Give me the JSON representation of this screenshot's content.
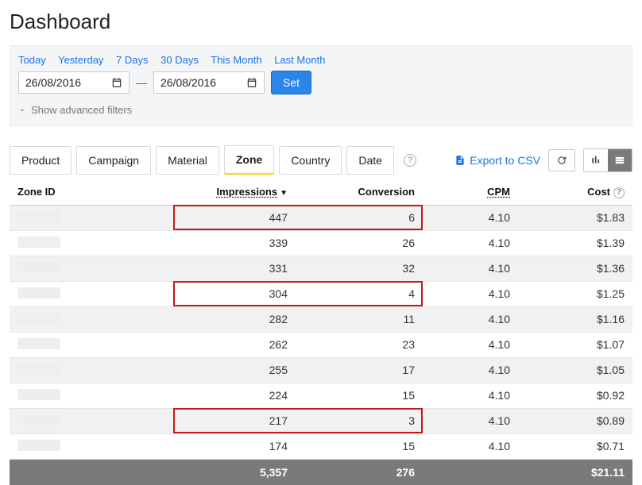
{
  "page": {
    "title": "Dashboard"
  },
  "filters": {
    "quick": {
      "today": "Today",
      "yesterday": "Yesterday",
      "d7": "7 Days",
      "d30": "30 Days",
      "this_month": "This Month",
      "last_month": "Last Month"
    },
    "date_from": "26/08/2016",
    "date_to": "26/08/2016",
    "set_label": "Set",
    "advanced_label": "Show advanced filters"
  },
  "tabs": {
    "product": "Product",
    "campaign": "Campaign",
    "material": "Material",
    "zone": "Zone",
    "country": "Country",
    "date": "Date",
    "active": "zone"
  },
  "toolbar": {
    "export_label": "Export to CSV"
  },
  "table": {
    "columns": {
      "zone_id": "Zone ID",
      "impressions": "Impressions",
      "conversion": "Conversion",
      "cpm": "CPM",
      "cost": "Cost"
    },
    "sort": {
      "column": "impressions",
      "dir": "desc"
    },
    "rows": [
      {
        "impressions": "447",
        "conversion": "6",
        "cpm": "4.10",
        "cost": "$1.83",
        "highlight": true
      },
      {
        "impressions": "339",
        "conversion": "26",
        "cpm": "4.10",
        "cost": "$1.39",
        "highlight": false
      },
      {
        "impressions": "331",
        "conversion": "32",
        "cpm": "4.10",
        "cost": "$1.36",
        "highlight": false
      },
      {
        "impressions": "304",
        "conversion": "4",
        "cpm": "4.10",
        "cost": "$1.25",
        "highlight": true
      },
      {
        "impressions": "282",
        "conversion": "11",
        "cpm": "4.10",
        "cost": "$1.16",
        "highlight": false
      },
      {
        "impressions": "262",
        "conversion": "23",
        "cpm": "4.10",
        "cost": "$1.07",
        "highlight": false
      },
      {
        "impressions": "255",
        "conversion": "17",
        "cpm": "4.10",
        "cost": "$1.05",
        "highlight": false
      },
      {
        "impressions": "224",
        "conversion": "15",
        "cpm": "4.10",
        "cost": "$0.92",
        "highlight": false
      },
      {
        "impressions": "217",
        "conversion": "3",
        "cpm": "4.10",
        "cost": "$0.89",
        "highlight": true
      },
      {
        "impressions": "174",
        "conversion": "15",
        "cpm": "4.10",
        "cost": "$0.71",
        "highlight": false
      }
    ],
    "totals": {
      "impressions": "5,357",
      "conversion": "276",
      "cpm": "",
      "cost": "$21.11"
    }
  }
}
